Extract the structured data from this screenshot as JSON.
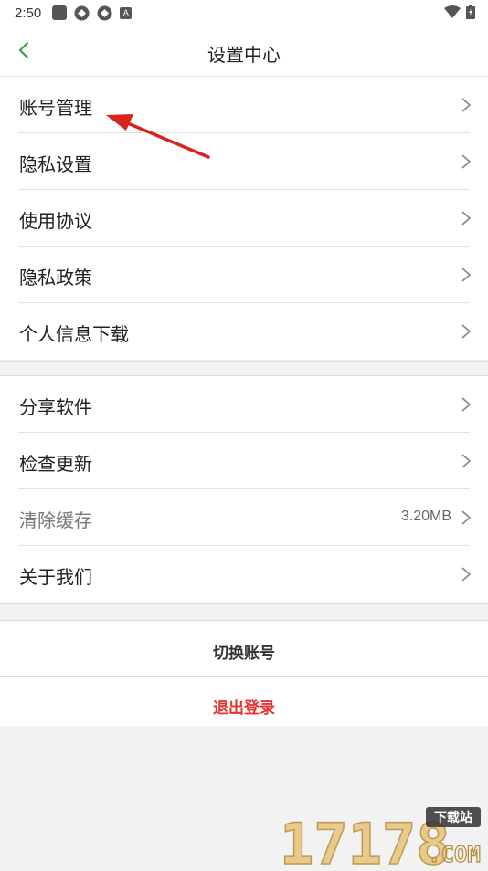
{
  "status_bar": {
    "time": "2:50",
    "icons": [
      "app-square-icon",
      "sync-icon",
      "sync-icon",
      "a-icon"
    ],
    "right_icons": [
      "wifi-icon",
      "battery-icon"
    ]
  },
  "header": {
    "title": "设置中心",
    "back_icon": "chevron-left-icon"
  },
  "group1": [
    {
      "label": "账号管理"
    },
    {
      "label": "隐私设置"
    },
    {
      "label": "使用协议"
    },
    {
      "label": "隐私政策"
    },
    {
      "label": "个人信息下载"
    }
  ],
  "group2": [
    {
      "label": "分享软件"
    },
    {
      "label": "检查更新"
    },
    {
      "label": "清除缓存",
      "value": "3.20MB"
    },
    {
      "label": "关于我们"
    }
  ],
  "actions": {
    "switch_account": "切换账号",
    "logout": "退出登录"
  },
  "watermark": {
    "number": "17178",
    "tag": "下载站",
    "domain": ".COM"
  },
  "colors": {
    "accent_green": "#3a9a3a",
    "logout_red": "#e8302c",
    "arrow_red": "#d9231f"
  }
}
